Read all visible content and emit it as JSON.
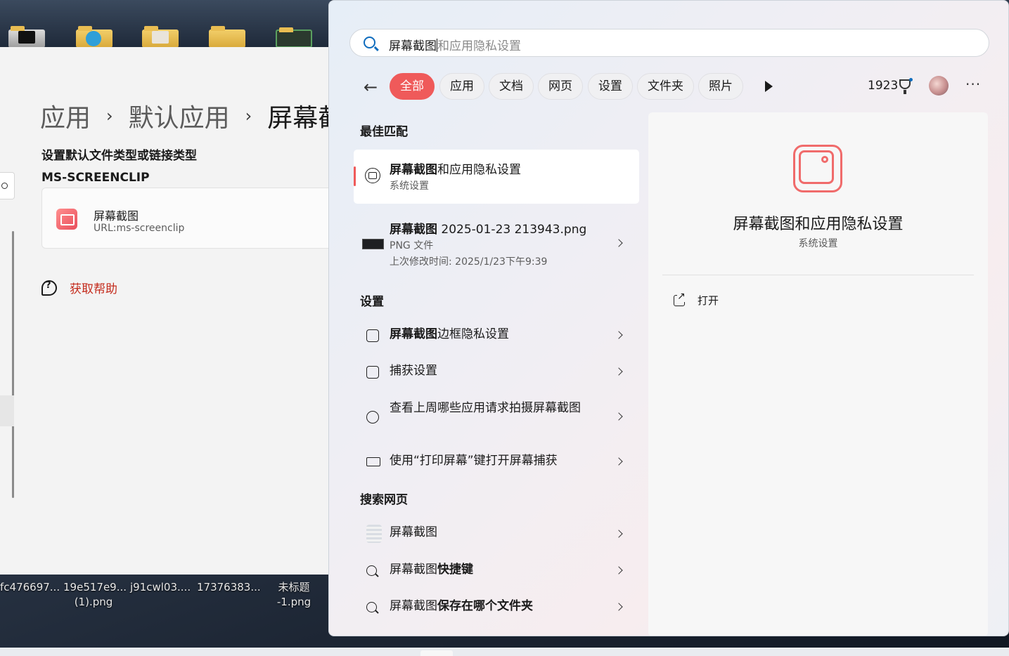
{
  "desktop": {
    "files": [
      {
        "label": "fc476697...",
        "label2": ""
      },
      {
        "label": "19e517e9...",
        "label2": "(1).png"
      },
      {
        "label": "j91cwl03....",
        "label2": ""
      },
      {
        "label": "17376383...",
        "label2": ""
      },
      {
        "label": "未标题",
        "label2": "-1.png"
      }
    ]
  },
  "settings": {
    "breadcrumb": [
      "应用",
      "默认应用",
      "屏幕截"
    ],
    "subheading": "设置默认文件类型或链接类型",
    "type_heading": "MS-SCREENCLIP",
    "app": {
      "name": "屏幕截图",
      "url": "URL:ms-screenclip"
    },
    "help_label": "获取帮助"
  },
  "search": {
    "query_typed": "屏幕截图",
    "query_suggestion": "和应用隐私设置",
    "filters": [
      "全部",
      "应用",
      "文档",
      "网页",
      "设置",
      "文件夹",
      "照片"
    ],
    "active_filter": "全部",
    "points": "1923",
    "sections": {
      "best": "最佳匹配",
      "settings": "设置",
      "web": "搜索网页"
    },
    "best_match": {
      "title_bold": "屏幕截图",
      "title_rest": "和应用隐私设置",
      "subtitle": "系统设置"
    },
    "file_result": {
      "title_bold": "屏幕截图",
      "title_rest": " 2025-01-23 213943.png",
      "type": "PNG 文件",
      "modified": "上次修改时间: 2025/1/23下午9:39"
    },
    "settings_results": [
      {
        "bold": "屏幕截图",
        "rest": "边框隐私设置"
      },
      {
        "bold": "",
        "rest": "捕获设置"
      },
      {
        "bold": "",
        "rest": "查看上周哪些应用请求拍摄屏幕截图"
      },
      {
        "bold": "",
        "rest": "使用“打印屏幕”键打开屏幕捕获"
      }
    ],
    "web_results": [
      {
        "plain": "屏幕截图",
        "bold": ""
      },
      {
        "plain": "屏幕截图",
        "bold": "快捷键"
      },
      {
        "plain": "屏幕截图",
        "bold": "保存在哪个文件夹"
      }
    ],
    "detail": {
      "title": "屏幕截图和应用隐私设置",
      "subtitle": "系统设置",
      "open_label": "打开"
    },
    "accent_color": "#ef5a5a"
  }
}
